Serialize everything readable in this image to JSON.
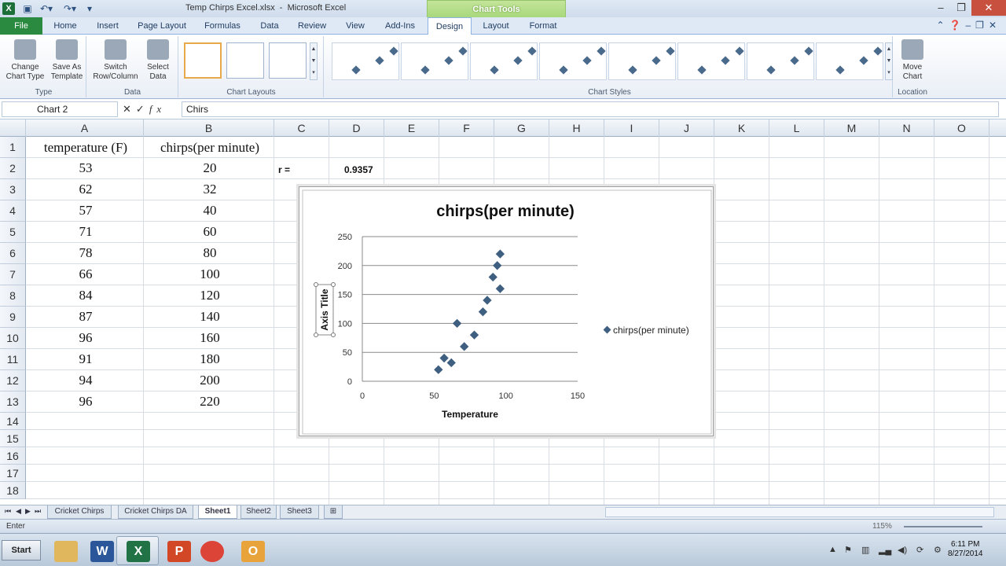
{
  "window": {
    "title": "Temp Chirps Excel.xlsx  -  Microsoft Excel",
    "chart_tools": "Chart Tools",
    "app_icon": "X"
  },
  "tabs": [
    "File",
    "Home",
    "Insert",
    "Page Layout",
    "Formulas",
    "Data",
    "Review",
    "View",
    "Add-Ins",
    "Design",
    "Layout",
    "Format"
  ],
  "ribbon": {
    "type_group": {
      "label": "Type",
      "change_chart_type": "Change Chart Type",
      "save_as_template": "Save As Template"
    },
    "data_group": {
      "label": "Data",
      "switch_row_column": "Switch Row/Column",
      "select_data": "Select Data"
    },
    "chart_layouts_label": "Chart Layouts",
    "chart_styles_label": "Chart Styles",
    "location_group": {
      "label": "Location",
      "move_chart": "Move Chart"
    }
  },
  "formula_bar": {
    "name_box": "Chart 2",
    "formula": "Chirs"
  },
  "columns": [
    "A",
    "B",
    "C",
    "D",
    "E",
    "F",
    "G",
    "H",
    "I",
    "J",
    "K",
    "L",
    "M",
    "N",
    "O"
  ],
  "rows": [
    "1",
    "2",
    "3",
    "4",
    "5",
    "6",
    "7",
    "8",
    "9",
    "10",
    "11",
    "12",
    "13",
    "14",
    "15",
    "16",
    "17",
    "18"
  ],
  "sheet": {
    "header_a": "temperature (F)",
    "header_b": "chirps(per minute)",
    "r_label": "r =",
    "r_value": "0.9357",
    "temperature": [
      "53",
      "62",
      "57",
      "71",
      "78",
      "66",
      "84",
      "87",
      "96",
      "91",
      "94",
      "96"
    ],
    "chirps": [
      "20",
      "32",
      "40",
      "60",
      "80",
      "100",
      "120",
      "140",
      "160",
      "180",
      "200",
      "220"
    ]
  },
  "chart_data": {
    "type": "scatter",
    "title": "chirps(per minute)",
    "xlabel": "Temperature",
    "ylabel": "Axis Title",
    "xlim": [
      0,
      150
    ],
    "ylim": [
      0,
      250
    ],
    "xticks": [
      0,
      50,
      100,
      150
    ],
    "yticks": [
      0,
      50,
      100,
      150,
      200,
      250
    ],
    "grid": "horizontal",
    "legend_position": "right",
    "series": [
      {
        "name": "chirps(per minute)",
        "color": "#3f5f80",
        "x": [
          53,
          62,
          57,
          71,
          78,
          66,
          84,
          87,
          96,
          91,
          94,
          96
        ],
        "y": [
          20,
          32,
          40,
          60,
          80,
          100,
          120,
          140,
          160,
          180,
          200,
          220
        ]
      }
    ]
  },
  "sheet_tabs": [
    "Cricket Chirps",
    "Cricket Chirps DA",
    "Sheet1",
    "Sheet2",
    "Sheet3"
  ],
  "active_sheet": "Sheet1",
  "status": {
    "mode": "Enter",
    "zoom": "115%"
  },
  "taskbar": {
    "start": "Start",
    "apps": [
      {
        "name": "explorer",
        "glyph": "",
        "color": "#e0b75c"
      },
      {
        "name": "word",
        "glyph": "W",
        "color": "#2b579a"
      },
      {
        "name": "excel",
        "glyph": "X",
        "color": "#217346"
      },
      {
        "name": "powerpoint",
        "glyph": "P",
        "color": "#d24726"
      },
      {
        "name": "chrome",
        "glyph": "",
        "color": "#db4437"
      },
      {
        "name": "outlook",
        "glyph": "O",
        "color": "#e8a33a"
      }
    ],
    "time": "6:11 PM",
    "date": "8/27/2014"
  }
}
